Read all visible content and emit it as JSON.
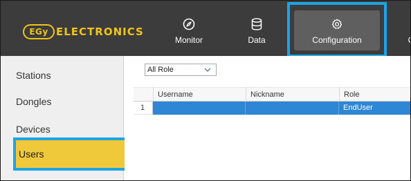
{
  "brand": {
    "badge": "EGy",
    "name": "ELECTRONICS",
    "color": "#f0c419"
  },
  "nav": {
    "items": [
      {
        "label": "Monitor",
        "icon": "compass-icon"
      },
      {
        "label": "Data",
        "icon": "database-icon"
      },
      {
        "label": "Configuration",
        "icon": "gear-icon",
        "active": true
      }
    ],
    "cutoff_label": "C"
  },
  "sidebar": {
    "items": [
      {
        "label": "Stations"
      },
      {
        "label": "Dongles"
      },
      {
        "label": "Devices"
      },
      {
        "label": "Users",
        "active": true
      }
    ]
  },
  "filter": {
    "role_value": "All Role"
  },
  "table": {
    "headers": [
      "Username",
      "Nickname",
      "Role"
    ],
    "rows": [
      {
        "index": "1",
        "username": "",
        "nickname": "",
        "role": "EndUser"
      }
    ]
  },
  "colors": {
    "header_bg": "#3c3c3c",
    "active_nav_bg": "#5f5f5f",
    "highlight_border": "#1da4e4",
    "active_sidebar_bg": "#f0c93a",
    "selected_row_bg": "#2f86d4"
  }
}
